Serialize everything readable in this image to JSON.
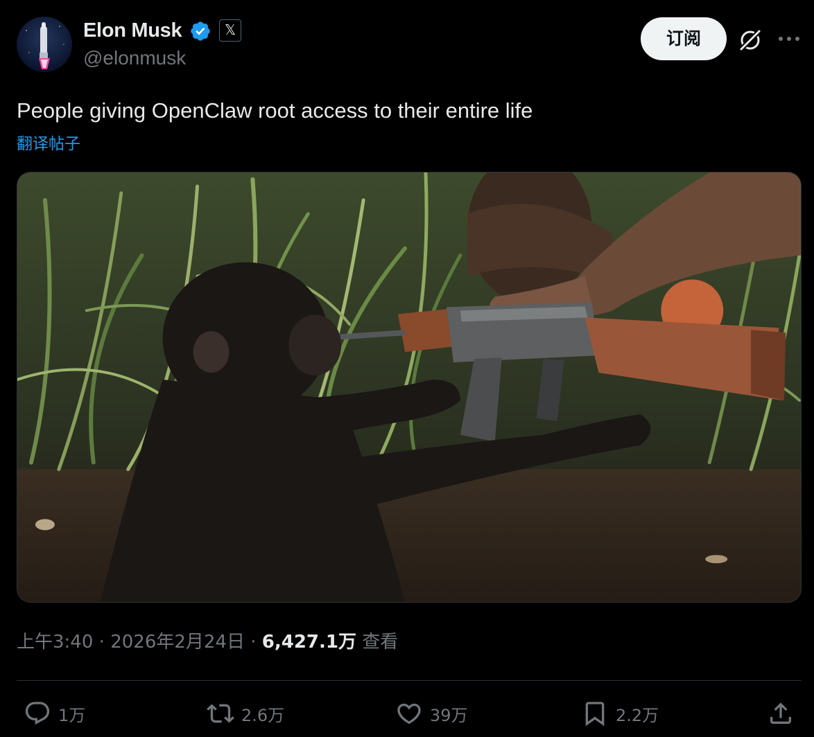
{
  "author": {
    "display_name": "Elon Musk",
    "handle": "@elonmusk",
    "verified": true,
    "affiliate_badge": "𝕏",
    "avatar_icon": "starship-avatar"
  },
  "header_actions": {
    "subscribe_label": "订阅",
    "grok_icon": "grok-icon",
    "more_icon": "more-icon"
  },
  "tweet": {
    "text": "People giving OpenClaw root access to their entire life",
    "translate_label": "翻译帖子",
    "media_description_icon": "photo"
  },
  "meta": {
    "time": "上午3:40",
    "separator": "·",
    "date": "2026年2月24日",
    "views_count": "6,427.1万",
    "views_label": "查看"
  },
  "actions": {
    "replies": "1万",
    "reposts": "2.6万",
    "likes": "39万",
    "bookmarks": "2.2万"
  },
  "colors": {
    "background": "#000000",
    "text_primary": "#e7e9ea",
    "text_secondary": "#71767b",
    "accent_blue": "#1d9bf0",
    "border": "#2f3336",
    "verified": "#1d9bf0"
  }
}
